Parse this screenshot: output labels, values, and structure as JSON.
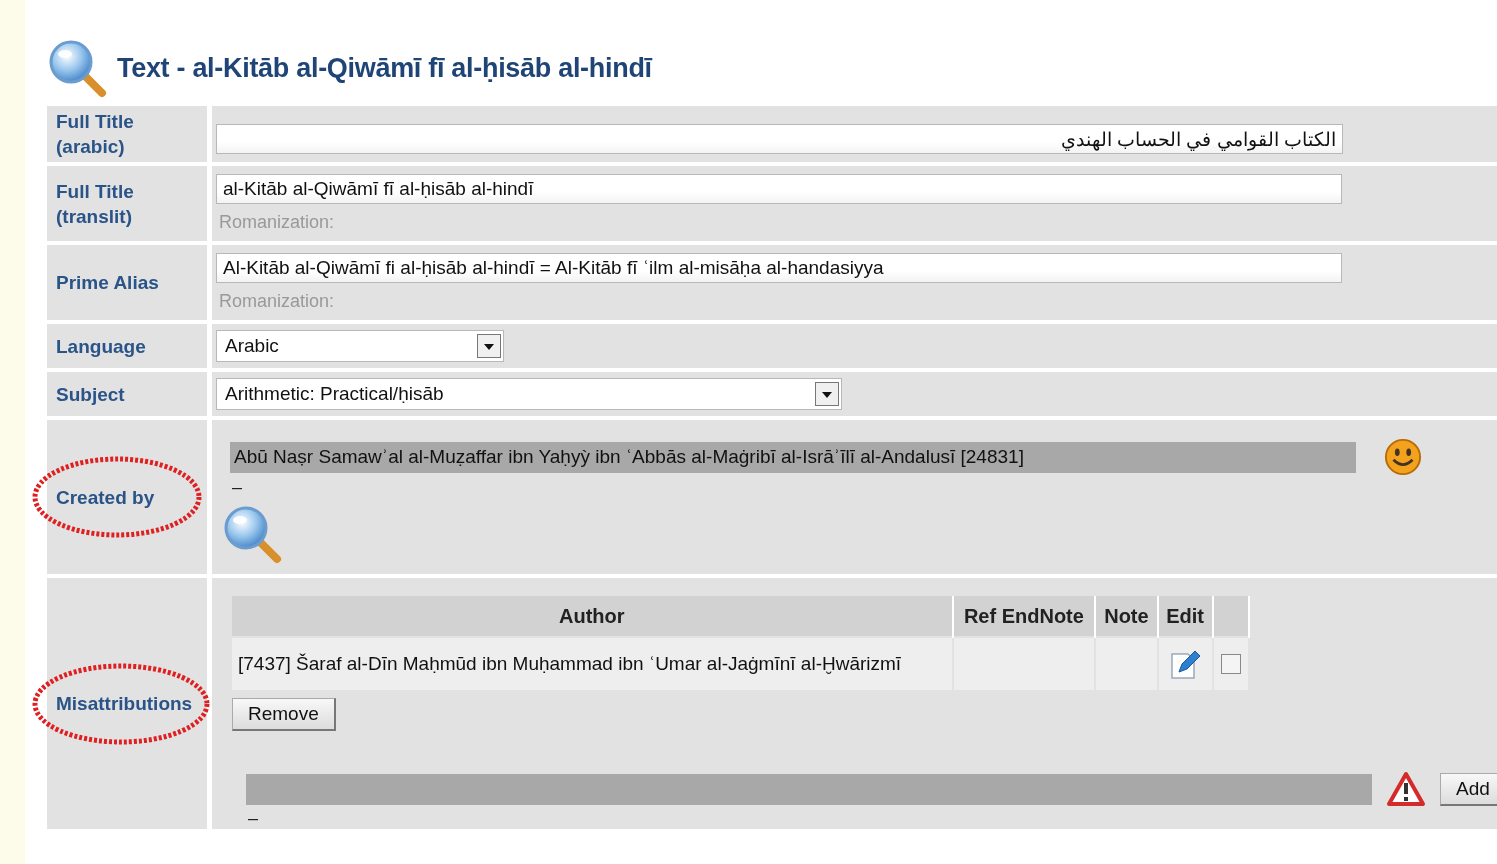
{
  "header": {
    "title": "Text - al-Kitāb al-Qiwāmī fī al-ḥisāb al-hindī"
  },
  "rows": [
    {
      "kind": "rtl_input",
      "label": "Full Title (arabic)",
      "value": "الكتاب القوامي في الحساب الهندي"
    },
    {
      "kind": "input",
      "label": "Full Title (translit)",
      "value": "al-Kitāb al-Qiwāmī fī al-ḥisāb al-hindī",
      "note": "Romanization:"
    },
    {
      "kind": "input",
      "label": "Prime Alias",
      "value": "Al-Kitāb al-Qiwāmī fi al-ḥisāb al-hindī = Al-Kitāb fī ʿilm al-misāḥa al-handasiyya",
      "note": "Romanization:"
    },
    {
      "kind": "select",
      "label": "Language",
      "value": "Arabic"
    },
    {
      "kind": "select",
      "label": "Subject",
      "value": "Arithmetic: Practical/ḥisāb"
    },
    {
      "kind": "creator",
      "label": "Created by",
      "annotated": true,
      "value": "Abū Naṣr Samawʾal al-Muẓaffar ibn Yaḥyỳ ibn ʿAbbās al-Maġribī al-Isrāʾīlī al-Andalusī [24831]",
      "sub": "–"
    },
    {
      "kind": "misattributions",
      "label": "Misattributions",
      "annotated": true,
      "columns": [
        "Author",
        "Ref EndNote",
        "Note",
        "Edit"
      ],
      "items": [
        {
          "author": "[7437] Šaraf al-Dīn Maḥmūd ibn Muḥammad ibn ʿUmar al-Jaġmīnī al-Ḫwārizmī",
          "checked": false
        }
      ],
      "remove_button": "Remove",
      "sub": "–",
      "add_button": "Add"
    }
  ]
}
